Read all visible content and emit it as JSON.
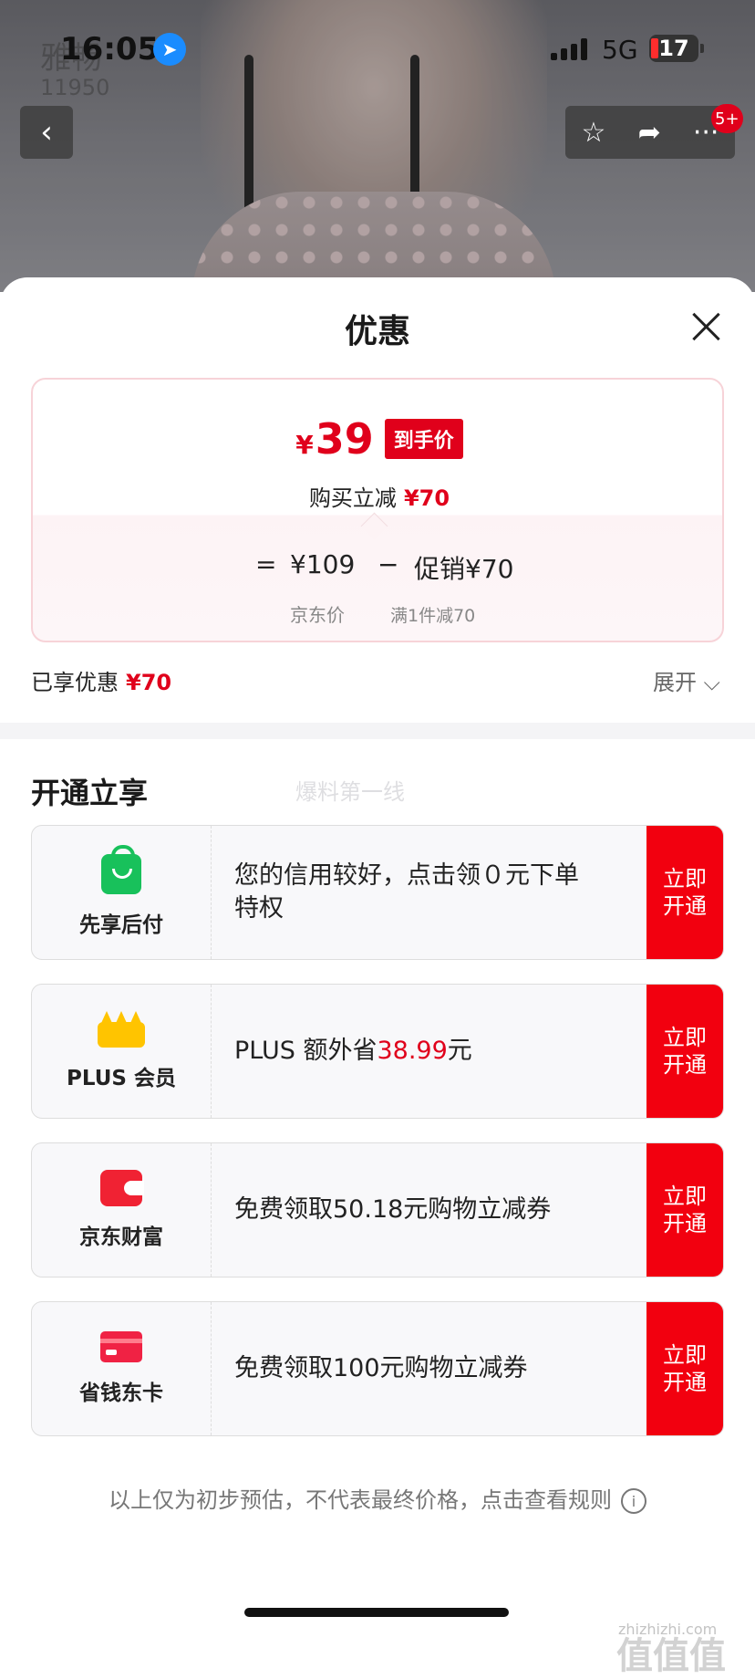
{
  "status": {
    "time": "16:05",
    "network": "5G",
    "battery": "17"
  },
  "header": {
    "store_name": "雅畅",
    "store_count": "11950",
    "back_icon": "chevron-left-icon",
    "cart_badge": "5+",
    "actions": [
      {
        "icon": "star-icon",
        "glyph": "☆"
      },
      {
        "icon": "share-icon",
        "glyph": "➦"
      },
      {
        "icon": "more-icon",
        "glyph": "···"
      }
    ]
  },
  "sheet": {
    "title": "优惠",
    "price": {
      "currency": "¥",
      "final": "39",
      "tag": "到手价",
      "reduce_label": "购买立减",
      "reduce_amount": "¥70",
      "eq": "=",
      "jd_price": "¥109",
      "minus": "−",
      "promo": "促销¥70",
      "jd_label": "京东价",
      "promo_detail": "满1件减70"
    },
    "enjoyed_label": "已享优惠",
    "enjoyed_amount": "¥70",
    "expand_label": "展开 ⌵",
    "section_title": "开通立享",
    "watermark": "爆料第一线",
    "offers": [
      {
        "icon": "shopping-bag-icon",
        "name": "先享后付",
        "desc": "您的信用较好，点击领０元下单特权",
        "cta": "立即\n开通"
      },
      {
        "icon": "crown-icon",
        "name": "PLUS 会员",
        "desc_prefix": "PLUS 额外省",
        "desc_highlight": "38.99",
        "desc_suffix": "元",
        "cta": "立即\n开通"
      },
      {
        "icon": "wallet-icon",
        "name": "京东财富",
        "desc": "免费领取50.18元购物立减券",
        "cta": "立即\n开通"
      },
      {
        "icon": "card-icon",
        "name": "省钱东卡",
        "desc": "免费领取100元购物立减券",
        "cta": "立即\n开通"
      }
    ],
    "footnote": "以上仅为初步预估，不代表最终价格，点击查看规则",
    "info_glyph": "i"
  },
  "watermark_site": {
    "logo": "值值值",
    "url": "zhizhizhi.com"
  },
  "colors": {
    "accent": "#e0001b",
    "cta": "#f2000f",
    "plus_gold": "#ffc400",
    "pay_green": "#18c15b"
  }
}
